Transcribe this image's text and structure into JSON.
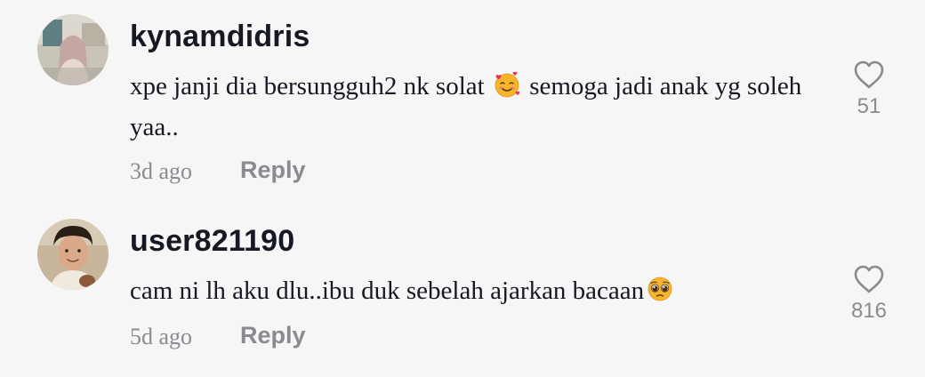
{
  "comments": [
    {
      "username": "kynamdidris",
      "text_before": "xpe janji dia bersungguh2 nk solat",
      "emoji_icon": "smiling-face-with-hearts-icon",
      "text_after": "semoga jadi anak yg soleh yaa..",
      "time": "3d ago",
      "reply_label": "Reply",
      "likes": "51",
      "heart_icon": "heart-outline-icon"
    },
    {
      "username": "user821190",
      "text_before": "cam ni lh aku dlu..ibu duk sebelah ajarkan bacaan",
      "emoji_icon": "pleading-face-icon",
      "text_after": "",
      "time": "5d ago",
      "reply_label": "Reply",
      "likes": "816",
      "heart_icon": "heart-outline-icon"
    }
  ],
  "colors": {
    "background": "#f6f6f6",
    "primary_text": "#161823",
    "secondary_text": "#8a8b91"
  }
}
